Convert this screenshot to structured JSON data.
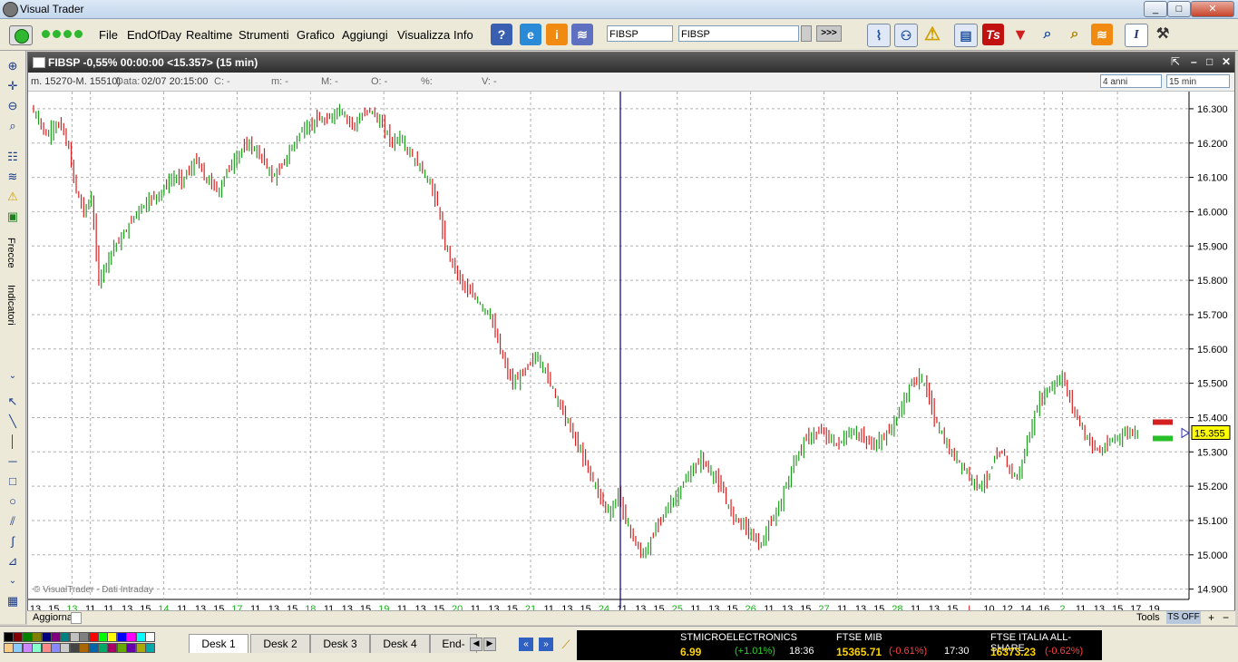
{
  "window": {
    "title": "Visual Trader",
    "minimize": "_",
    "maximize": "□",
    "close": "✕"
  },
  "menu": [
    "File",
    "EndOfDay",
    "Realtime",
    "Strumenti",
    "Grafico",
    "Aggiungi",
    "Visualizza",
    "Info"
  ],
  "toolbar": {
    "symbol_field": "FIBSP",
    "symbol_combo": "FIBSP",
    "go_label": ">>>"
  },
  "left_tabs": {
    "arrows": "Frecce",
    "indicators": "Indicatori"
  },
  "chart": {
    "title": "FIBSP -0,55% 00:00:00  <15.357> (15 min)",
    "info": {
      "range": "m. 15270-M. 15510)",
      "date_label": "Data:",
      "date_value": "02/07 20:15:00",
      "c": "C:  -",
      "m": "m:  -",
      "M": "M:  -",
      "O": "O:  -",
      "pct": "%:",
      "v": "V:  -"
    },
    "period_select": "4 anni",
    "interval_select": "15 min",
    "copyright": "© VisualTrader - Dati Intraday",
    "last_price": "15.355",
    "colors": {
      "up": "#1e9e1e",
      "down": "#d42020",
      "grid": "#b0b0b0",
      "cursor": "#00007a"
    }
  },
  "chart_data": {
    "type": "ohlc",
    "y_ticks": [
      "16.300",
      "16.200",
      "16.100",
      "16.000",
      "15.900",
      "15.800",
      "15.700",
      "15.600",
      "15.500",
      "15.400",
      "15.300",
      "15.200",
      "15.100",
      "15.000",
      "14.900"
    ],
    "ylim": [
      14.87,
      16.35
    ],
    "x_labels": [
      {
        "t": "13",
        "c": "#000"
      },
      {
        "t": "15",
        "c": "#000"
      },
      {
        "t": "13",
        "c": "#18b018"
      },
      {
        "t": "11",
        "c": "#000"
      },
      {
        "t": "11",
        "c": "#000"
      },
      {
        "t": "13",
        "c": "#000"
      },
      {
        "t": "15",
        "c": "#000"
      },
      {
        "t": "14",
        "c": "#18b018"
      },
      {
        "t": "11",
        "c": "#000"
      },
      {
        "t": "13",
        "c": "#000"
      },
      {
        "t": "15",
        "c": "#000"
      },
      {
        "t": "17",
        "c": "#18b018"
      },
      {
        "t": "11",
        "c": "#000"
      },
      {
        "t": "13",
        "c": "#000"
      },
      {
        "t": "15",
        "c": "#000"
      },
      {
        "t": "18",
        "c": "#18b018"
      },
      {
        "t": "11",
        "c": "#000"
      },
      {
        "t": "13",
        "c": "#000"
      },
      {
        "t": "15",
        "c": "#000"
      },
      {
        "t": "19",
        "c": "#18b018"
      },
      {
        "t": "11",
        "c": "#000"
      },
      {
        "t": "13",
        "c": "#000"
      },
      {
        "t": "15",
        "c": "#000"
      },
      {
        "t": "20",
        "c": "#18b018"
      },
      {
        "t": "11",
        "c": "#000"
      },
      {
        "t": "13",
        "c": "#000"
      },
      {
        "t": "15",
        "c": "#000"
      },
      {
        "t": "21",
        "c": "#18b018"
      },
      {
        "t": "11",
        "c": "#000"
      },
      {
        "t": "13",
        "c": "#000"
      },
      {
        "t": "15",
        "c": "#000"
      },
      {
        "t": "24",
        "c": "#18b018"
      },
      {
        "t": "11",
        "c": "#000"
      },
      {
        "t": "13",
        "c": "#000"
      },
      {
        "t": "15",
        "c": "#000"
      },
      {
        "t": "25",
        "c": "#18b018"
      },
      {
        "t": "11",
        "c": "#000"
      },
      {
        "t": "13",
        "c": "#000"
      },
      {
        "t": "15",
        "c": "#000"
      },
      {
        "t": "26",
        "c": "#18b018"
      },
      {
        "t": "11",
        "c": "#000"
      },
      {
        "t": "13",
        "c": "#000"
      },
      {
        "t": "15",
        "c": "#000"
      },
      {
        "t": "27",
        "c": "#18b018"
      },
      {
        "t": "11",
        "c": "#000"
      },
      {
        "t": "13",
        "c": "#000"
      },
      {
        "t": "15",
        "c": "#000"
      },
      {
        "t": "28",
        "c": "#18b018"
      },
      {
        "t": "11",
        "c": "#000"
      },
      {
        "t": "13",
        "c": "#000"
      },
      {
        "t": "15",
        "c": "#000"
      },
      {
        "t": "L",
        "c": "#d42020"
      },
      {
        "t": "10",
        "c": "#000"
      },
      {
        "t": "12",
        "c": "#000"
      },
      {
        "t": "14",
        "c": "#000"
      },
      {
        "t": "16",
        "c": "#000"
      },
      {
        "t": "2",
        "c": "#18b018"
      },
      {
        "t": "11",
        "c": "#000"
      },
      {
        "t": "13",
        "c": "#000"
      },
      {
        "t": "15",
        "c": "#000"
      },
      {
        "t": "17",
        "c": "#000"
      },
      {
        "t": "19",
        "c": "#000"
      }
    ],
    "series": [
      {
        "values": [
          16.3,
          16.27,
          16.22,
          16.25,
          16.25,
          16.18,
          16.06,
          16.0,
          16.04,
          15.8,
          15.85,
          15.9,
          15.92,
          15.96,
          16.0,
          16.02,
          16.04,
          16.05,
          16.08,
          16.1,
          16.09,
          16.12,
          16.15,
          16.1,
          16.08,
          16.06,
          16.12,
          16.15,
          16.18,
          16.2,
          16.17,
          16.15,
          16.1,
          16.12,
          16.16,
          16.2,
          16.24,
          16.25,
          16.27,
          16.26,
          16.28,
          16.3,
          16.27,
          16.25,
          16.28,
          16.3,
          16.27,
          16.24,
          16.2,
          16.22,
          16.18,
          16.15,
          16.12,
          16.08,
          16.02,
          15.9,
          15.85,
          15.8,
          15.77,
          15.75,
          15.72,
          15.7,
          15.62,
          15.55,
          15.5,
          15.52,
          15.55,
          15.58,
          15.55,
          15.5,
          15.45,
          15.4,
          15.35,
          15.3,
          15.25,
          15.2,
          15.15,
          15.12,
          15.18,
          15.1,
          15.05,
          15.0,
          15.02,
          15.08,
          15.12,
          15.15,
          15.18,
          15.22,
          15.25,
          15.28,
          15.25,
          15.22,
          15.18,
          15.12,
          15.1,
          15.08,
          15.05,
          15.03,
          15.08,
          15.12,
          15.18,
          15.25,
          15.3,
          15.34,
          15.35,
          15.36,
          15.34,
          15.32,
          15.34,
          15.36,
          15.35,
          15.33,
          15.32,
          15.34,
          15.36,
          15.4,
          15.45,
          15.5,
          15.52,
          15.48,
          15.4,
          15.35,
          15.3,
          15.28,
          15.25,
          15.22,
          15.2,
          15.22,
          15.28,
          15.3,
          15.25,
          15.22,
          15.3,
          15.38,
          15.45,
          15.48,
          15.5,
          15.52,
          15.45,
          15.4,
          15.35,
          15.32,
          15.3,
          15.32,
          15.34,
          15.35,
          15.36,
          15.355
        ]
      }
    ]
  },
  "statusbar": {
    "refresh": "Aggiorna",
    "tools": "Tools",
    "ts": "TS OFF",
    "plus": "+",
    "minus": "−"
  },
  "tabs": [
    "Desk 1",
    "Desk 2",
    "Desk 3",
    "Desk 4",
    "End-"
  ],
  "tickers": [
    {
      "name": "STMICROELECTRONICS",
      "price": "6.99",
      "change": "(+1.01%)",
      "time": "18:36"
    },
    {
      "name": "FTSE MIB",
      "price": "15365.71",
      "change": "(-0.61%)",
      "time": "17:30"
    },
    {
      "name": "FTSE ITALIA ALL-SHARE",
      "price": "16373.23",
      "change": "(-0.62%)",
      "time": ""
    }
  ]
}
